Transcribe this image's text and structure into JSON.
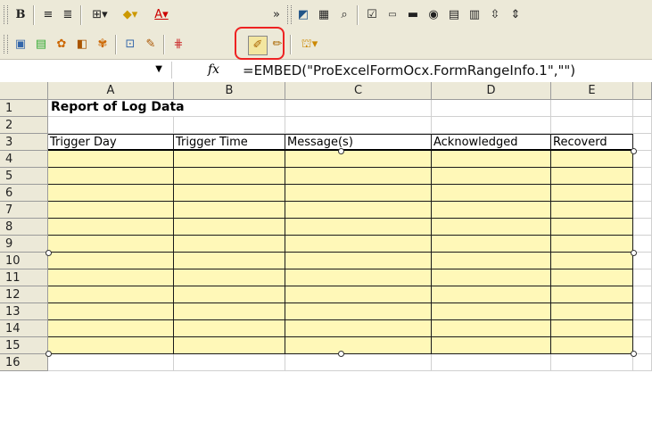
{
  "toolbar": {
    "row1": [
      "bold-icon",
      "align-right-icon",
      "align-justify-icon",
      "borders-icon",
      "fill-color-icon",
      "font-color-icon",
      "toolbar-overflow-icon",
      "chart-wizard-icon",
      "properties-icon",
      "view-code-icon",
      "checkbox-control-icon",
      "textbox-control-icon",
      "button-control-icon",
      "option-button-icon",
      "combobox-icon",
      "listbox-icon",
      "scrollbar-control-icon",
      "spinner-icon"
    ],
    "row2": [
      "form-icon-1",
      "form-icon-2",
      "form-icon-3",
      "form-icon-4",
      "form-icon-5",
      "form-icon-6",
      "form-icon-7",
      "form-icon-8",
      "form-range-info-icon",
      "form-icon-10",
      "form-icon-11"
    ]
  },
  "formula_bar": {
    "name_box": "",
    "fx": "fx",
    "formula": "=EMBED(\"ProExcelFormOcx.FormRangeInfo.1\",\"\")"
  },
  "columns": [
    "A",
    "B",
    "C",
    "D",
    "E"
  ],
  "rows": [
    "1",
    "2",
    "3",
    "4",
    "5",
    "6",
    "7",
    "8",
    "9",
    "10",
    "11",
    "12",
    "13",
    "14",
    "15",
    "16"
  ],
  "sheet": {
    "title": "Report of Log Data",
    "headers": [
      "Trigger Day",
      "Trigger Time",
      "Message(s)",
      "Acknowledged",
      "Recoverd"
    ]
  },
  "colors": {
    "highlight": "#e22222",
    "range_fill": "#fff8b8"
  }
}
